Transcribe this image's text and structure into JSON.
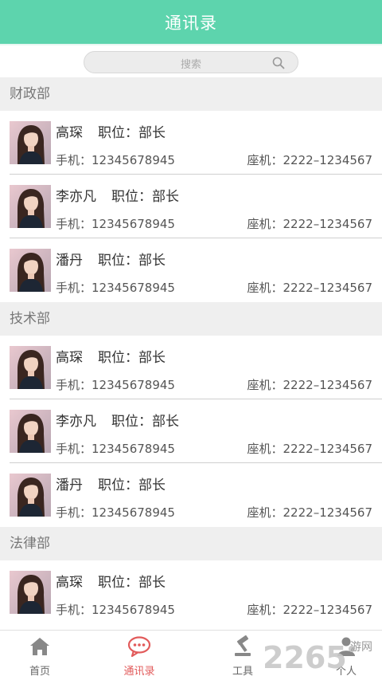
{
  "header": {
    "title": "通讯录"
  },
  "search": {
    "placeholder": "搜索"
  },
  "sections": [
    {
      "name": "财政部",
      "contacts": [
        {
          "name": "高琛",
          "position": "职位：部长",
          "mobile": "手机：12345678945",
          "landline": "座机：2222–1234567"
        },
        {
          "name": "李亦凡",
          "position": "职位：部长",
          "mobile": "手机：12345678945",
          "landline": "座机：2222–1234567"
        },
        {
          "name": "潘丹",
          "position": "职位：部长",
          "mobile": "手机：12345678945",
          "landline": "座机：2222–1234567"
        }
      ]
    },
    {
      "name": "技术部",
      "contacts": [
        {
          "name": "高琛",
          "position": "职位：部长",
          "mobile": "手机：12345678945",
          "landline": "座机：2222–1234567"
        },
        {
          "name": "李亦凡",
          "position": "职位：部长",
          "mobile": "手机：12345678945",
          "landline": "座机：2222–1234567"
        },
        {
          "name": "潘丹",
          "position": "职位：部长",
          "mobile": "手机：12345678945",
          "landline": "座机：2222–1234567"
        }
      ]
    },
    {
      "name": "法律部",
      "contacts": [
        {
          "name": "高琛",
          "position": "职位：部长",
          "mobile": "手机：12345678945",
          "landline": "座机：2222–1234567"
        }
      ]
    }
  ],
  "tabs": [
    {
      "label": "首页",
      "icon": "home-icon",
      "active": false
    },
    {
      "label": "通讯录",
      "icon": "chat-icon",
      "active": true
    },
    {
      "label": "工具",
      "icon": "tools-icon",
      "active": false
    },
    {
      "label": "个人",
      "icon": "person-icon",
      "active": false
    }
  ],
  "watermark": {
    "brand": "2265",
    "text": "游网"
  },
  "colors": {
    "header": "#5dd4ad",
    "active_tab": "#e25b5b",
    "section_bg": "#efefef"
  }
}
